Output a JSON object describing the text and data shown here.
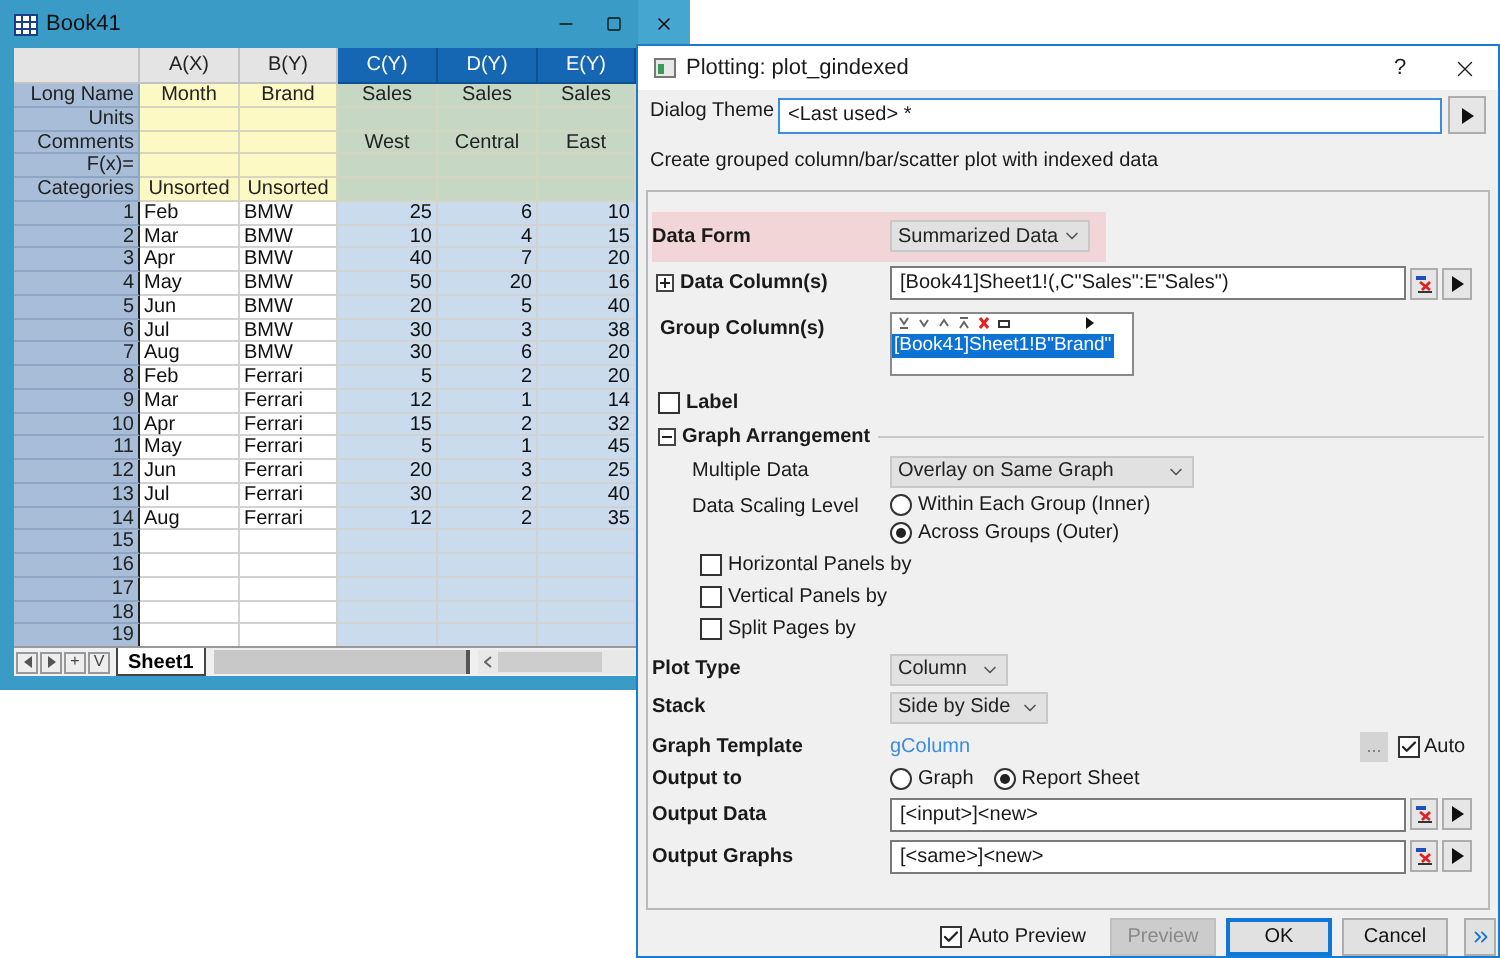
{
  "workbook": {
    "title": "Book41",
    "columns": [
      {
        "label": "A(X)",
        "selected": false
      },
      {
        "label": "B(Y)",
        "selected": false
      },
      {
        "label": "C(Y)",
        "selected": true
      },
      {
        "label": "D(Y)",
        "selected": true
      },
      {
        "label": "E(Y)",
        "selected": true
      }
    ],
    "meta_rows": [
      {
        "label": "Long Name",
        "cells": [
          "Month",
          "Brand",
          "Sales",
          "Sales",
          "Sales"
        ]
      },
      {
        "label": "Units"
      },
      {
        "label": "Comments",
        "cells": [
          null,
          null,
          "West",
          "Central",
          "East"
        ]
      },
      {
        "label": "F(x)="
      },
      {
        "label": "Categories",
        "cells": [
          "Unsorted",
          "Unsorted"
        ]
      }
    ],
    "rows": [
      {
        "number": "1",
        "cells": [
          "Feb",
          "BMW",
          "25",
          "6",
          "10"
        ]
      },
      {
        "number": "2",
        "cells": [
          "Mar",
          "BMW",
          "10",
          "4",
          "15"
        ]
      },
      {
        "number": "3",
        "cells": [
          "Apr",
          "BMW",
          "40",
          "7",
          "20"
        ]
      },
      {
        "number": "4",
        "cells": [
          "May",
          "BMW",
          "50",
          "20",
          "16"
        ]
      },
      {
        "number": "5",
        "cells": [
          "Jun",
          "BMW",
          "20",
          "5",
          "40"
        ]
      },
      {
        "number": "6",
        "cells": [
          "Jul",
          "BMW",
          "30",
          "3",
          "38"
        ]
      },
      {
        "number": "7",
        "cells": [
          "Aug",
          "BMW",
          "30",
          "6",
          "20"
        ]
      },
      {
        "number": "8",
        "cells": [
          "Feb",
          "Ferrari",
          "5",
          "2",
          "20"
        ]
      },
      {
        "number": "9",
        "cells": [
          "Mar",
          "Ferrari",
          "12",
          "1",
          "14"
        ]
      },
      {
        "number": "10",
        "cells": [
          "Apr",
          "Ferrari",
          "15",
          "2",
          "32"
        ]
      },
      {
        "number": "11",
        "cells": [
          "May",
          "Ferrari",
          "5",
          "1",
          "45"
        ]
      },
      {
        "number": "12",
        "cells": [
          "Jun",
          "Ferrari",
          "20",
          "3",
          "25"
        ]
      },
      {
        "number": "13",
        "cells": [
          "Jul",
          "Ferrari",
          "30",
          "2",
          "40"
        ]
      },
      {
        "number": "14",
        "cells": [
          "Aug",
          "Ferrari",
          "12",
          "2",
          "35"
        ]
      },
      {
        "number": "15"
      },
      {
        "number": "16"
      },
      {
        "number": "17"
      },
      {
        "number": "18"
      },
      {
        "number": "19"
      }
    ],
    "nav_buttons": [
      "+",
      "V"
    ],
    "sheet_tabs": [
      {
        "label": "Sheet1",
        "selected": true
      }
    ]
  },
  "dialog": {
    "title": "Plotting: plot_gindexed",
    "help": "?",
    "theme": {
      "label": "Dialog Theme",
      "value": "<Last used> *"
    },
    "description": "Create grouped column/bar/scatter plot with indexed data",
    "data_form": {
      "label": "Data Form",
      "value": "Summarized Data",
      "highlighted": true
    },
    "data_columns": {
      "label": "Data Column(s)",
      "expanded": false,
      "value": "[Book41]Sheet1!(,C\"Sales\":E\"Sales\")"
    },
    "group_columns": {
      "label": "Group Column(s)",
      "items": [
        {
          "text": "[Book41]Sheet1!B\"Brand\"",
          "selected": true
        }
      ]
    },
    "label_option": {
      "label": "Label",
      "checked": false
    },
    "graph_arrangement": {
      "label": "Graph Arrangement",
      "expanded": true
    },
    "multiple_data": {
      "label": "Multiple Data",
      "value": "Overlay on Same Graph"
    },
    "data_scaling_level": {
      "label": "Data Scaling Level",
      "options": [
        {
          "label": "Within Each Group (Inner)",
          "selected": false
        },
        {
          "label": "Across Groups (Outer)",
          "selected": true
        }
      ]
    },
    "panel_options": [
      {
        "label": "Horizontal Panels by",
        "checked": false
      },
      {
        "label": "Vertical Panels by",
        "checked": false
      },
      {
        "label": "Split Pages by",
        "checked": false
      }
    ],
    "plot_type": {
      "label": "Plot Type",
      "value": "Column"
    },
    "stack": {
      "label": "Stack",
      "value": "Side by Side"
    },
    "graph_template": {
      "label": "Graph Template",
      "value": "gColumn",
      "browse": "...",
      "auto": {
        "label": "Auto",
        "checked": true
      }
    },
    "output_to": {
      "label": "Output to",
      "options": [
        {
          "label": "Graph",
          "selected": false
        },
        {
          "label": "Report Sheet",
          "selected": true
        }
      ]
    },
    "output_data": {
      "label": "Output Data",
      "value": "[<input>]<new>"
    },
    "output_graphs": {
      "label": "Output Graphs",
      "value": "[<same>]<new>"
    },
    "auto_preview": {
      "label": "Auto Preview",
      "checked": true
    },
    "buttons": [
      {
        "label": "Preview",
        "disabled": true,
        "default": false
      },
      {
        "label": "OK",
        "disabled": false,
        "default": true
      },
      {
        "label": "Cancel",
        "disabled": false,
        "default": false
      }
    ]
  }
}
